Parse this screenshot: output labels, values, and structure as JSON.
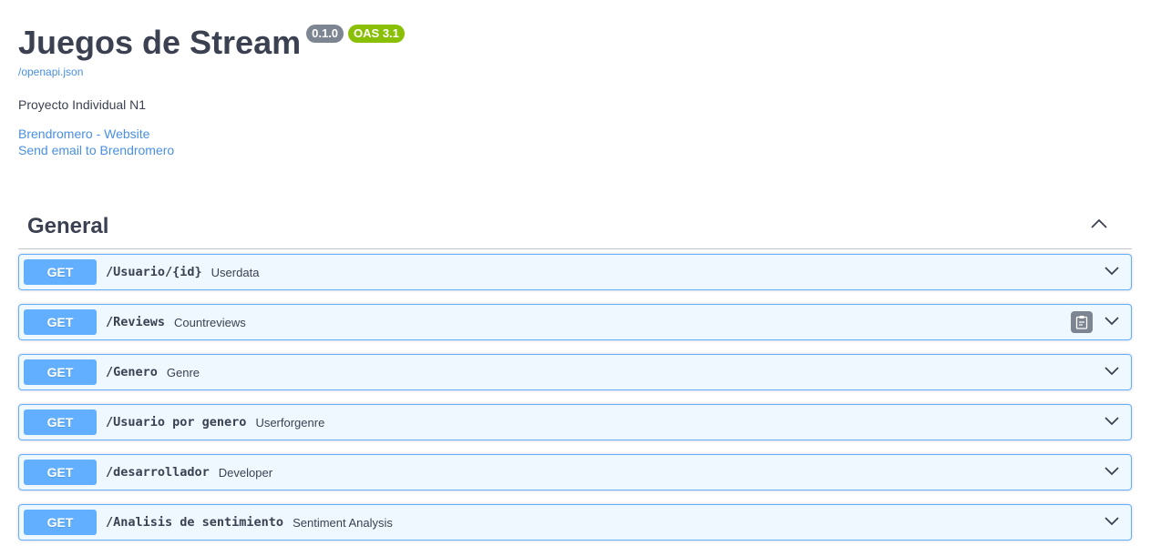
{
  "info": {
    "title": "Juegos de Stream",
    "version": "0.1.0",
    "oas_version": "OAS 3.1",
    "spec_url": "/openapi.json",
    "description": "Proyecto Individual N1",
    "website_link": "Brendromero - Website",
    "email_link": "Send email to Brendromero"
  },
  "section": {
    "title": "General",
    "expanded_icon": "chevron-up-icon"
  },
  "operations": [
    {
      "method": "GET",
      "path": "/Usuario/{id}",
      "summary": "Userdata"
    },
    {
      "method": "GET",
      "path": "/Reviews",
      "summary": "Countreviews"
    },
    {
      "method": "GET",
      "path": "/Genero",
      "summary": "Genre"
    },
    {
      "method": "GET",
      "path": "/Usuario por genero",
      "summary": "Userforgenre"
    },
    {
      "method": "GET",
      "path": "/desarrollador",
      "summary": "Developer"
    },
    {
      "method": "GET",
      "path": "/Analisis de sentimiento",
      "summary": "Sentiment Analysis"
    }
  ],
  "colors": {
    "get_method": "#61affe",
    "version_badge": "#7d8492",
    "oas_badge": "#89bf04",
    "link": "#4990e2"
  }
}
